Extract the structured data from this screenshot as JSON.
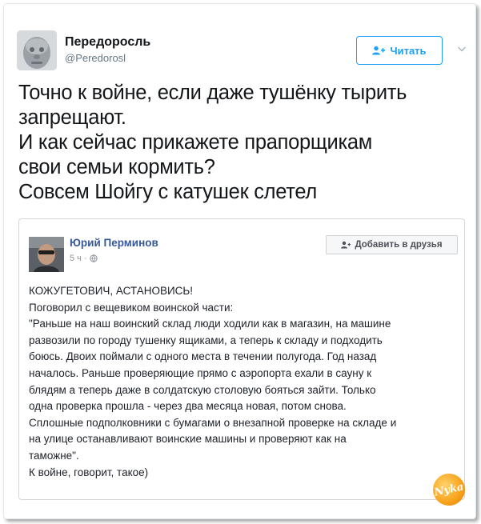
{
  "tweet": {
    "author_name": "Передоросль",
    "author_handle": "@Peredorosl",
    "follow_label": "Читать",
    "text_lines": [
      "Точно к войне, если даже тушёнку тырить",
      "запрещают.",
      "И как сейчас прикажете прапорщикам",
      "свои семьи кормить?",
      "Совсем Шойгу с катушек слетел"
    ]
  },
  "embed": {
    "author_name": "Юрий Перминов",
    "time": "5 ч ·",
    "add_friend_label": "Добавить в друзья",
    "body_lines": [
      "КОЖУГЕТОВИЧ, АСТАНОВИСЬ!",
      "Поговорил с вещевиком воинской части:",
      "\"Раньше на наш воинский склад люди ходили как в магазин, на машине",
      "развозили по городу тушенку ящиками, а теперь к складу и подходить",
      "боюсь. Двоих поймали с одного места в течении полугода. Год назад",
      "началось. Раньше проверяющие прямо с аэропорта ехали в сауну к",
      "блядям а теперь даже в солдатскую столовую бояться зайти. Только",
      "одна проверка прошла - через два месяца новая, потом снова.",
      "Сплошные подполковники с бумагами о внезапной проверке на складе и",
      "на улице останавливают воинские машины и проверяют как на",
      "таможне\".",
      "К войне, говорит, такое)"
    ]
  },
  "watermark": {
    "text": "Nyka"
  },
  "icons": {
    "follow": "person-plus-icon",
    "chevron": "chevron-down-icon",
    "globe": "globe-icon",
    "add_friend": "add-friend-icon"
  },
  "colors": {
    "twitter_blue": "#1da1f2",
    "fb_name_blue": "#365899",
    "text": "#14171a"
  }
}
